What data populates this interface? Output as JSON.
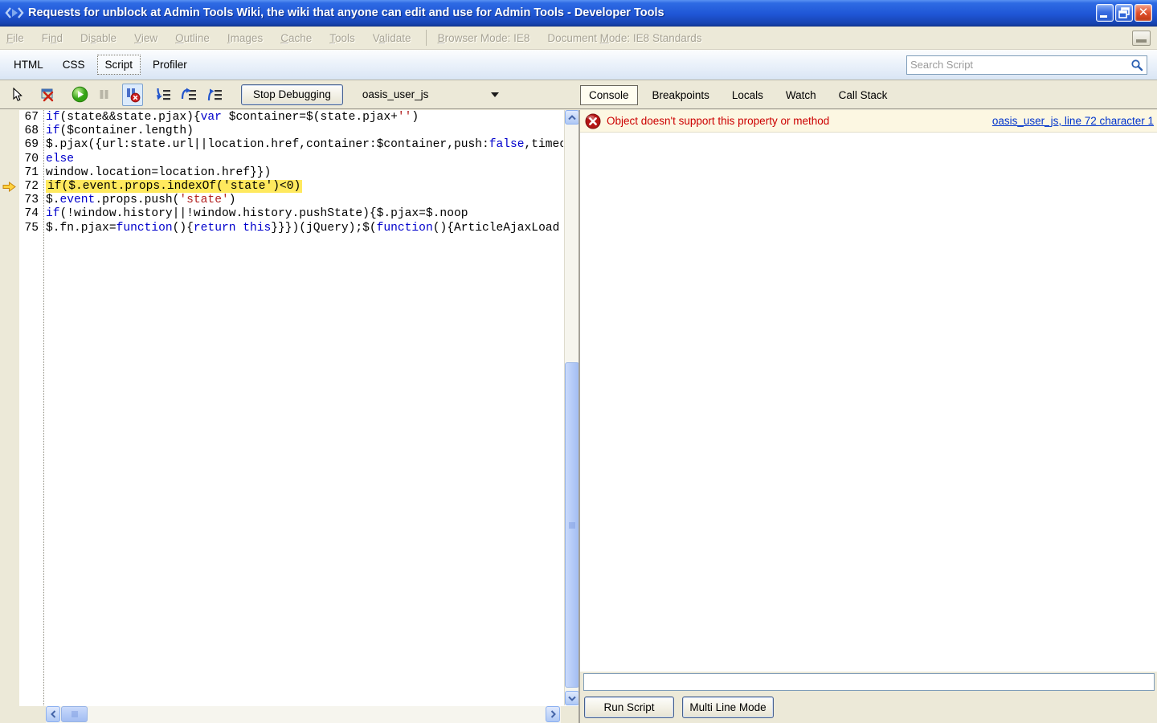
{
  "titlebar": {
    "title": "Requests for unblock at Admin Tools Wiki, the wiki that anyone can edit and use for Admin Tools - Developer Tools",
    "icon": "code-brackets-icon",
    "buttons": [
      "minimize-icon",
      "restore-icon",
      "close-icon"
    ]
  },
  "menubar": {
    "items": [
      {
        "label": "File",
        "u": 0
      },
      {
        "label": "Find",
        "u": 2
      },
      {
        "label": "Disable",
        "u": 2
      },
      {
        "label": "View",
        "u": 0
      },
      {
        "label": "Outline",
        "u": 0
      },
      {
        "label": "Images",
        "u": 0
      },
      {
        "label": "Cache",
        "u": 0
      },
      {
        "label": "Tools",
        "u": 0
      },
      {
        "label": "Validate",
        "u": 1
      }
    ],
    "modes": [
      {
        "label": "Browser Mode: IE8",
        "u": 0
      },
      {
        "label": "Document Mode: IE8 Standards",
        "u": 9
      }
    ],
    "pin_button": "minimize-pane-icon"
  },
  "dev_tabs": {
    "items": [
      {
        "label": "HTML",
        "selected": false
      },
      {
        "label": "CSS",
        "selected": false
      },
      {
        "label": "Script",
        "selected": true
      },
      {
        "label": "Profiler",
        "selected": false
      }
    ]
  },
  "search": {
    "placeholder": "Search Script",
    "icon": "search-icon"
  },
  "toolbar": {
    "icons": [
      "select-element-icon",
      "window-error-icon",
      "continue-icon",
      "break-all-icon",
      "break-on-error-icon",
      "step-into-icon",
      "step-over-icon",
      "step-out-icon"
    ],
    "stop_debugging_label": "Stop Debugging",
    "script_selector_value": "oasis_user_js",
    "script_selector_icon": "chevron-down-icon"
  },
  "console_tabs": {
    "items": [
      {
        "label": "Console",
        "selected": true
      },
      {
        "label": "Breakpoints",
        "selected": false
      },
      {
        "label": "Locals",
        "selected": false
      },
      {
        "label": "Watch",
        "selected": false
      },
      {
        "label": "Call Stack",
        "selected": false
      }
    ]
  },
  "console": {
    "error": {
      "icon": "error-icon",
      "message": "Object doesn't support this property or method",
      "location_link": "oasis_user_js, line 72 character 1"
    },
    "input_value": "",
    "run_button_label": "Run Script",
    "multiline_button_label": "Multi Line Mode"
  },
  "code": {
    "execution_line": 72,
    "lines": [
      {
        "num": 67,
        "tokens": [
          [
            "k",
            "if"
          ],
          [
            "p",
            "(state&&state.pjax){"
          ],
          [
            "k",
            "var"
          ],
          [
            "p",
            " $container=$(state.pjax+"
          ],
          [
            "s",
            "''"
          ],
          [
            "p",
            ")"
          ]
        ]
      },
      {
        "num": 68,
        "tokens": [
          [
            "k",
            "if"
          ],
          [
            "p",
            "($container.length)"
          ]
        ]
      },
      {
        "num": 69,
        "tokens": [
          [
            "p",
            "$.pjax({url:state.url||location.href,container:$container,push:"
          ],
          [
            "k",
            "false"
          ],
          [
            "p",
            ",timeout:"
          ]
        ]
      },
      {
        "num": 70,
        "tokens": [
          [
            "k",
            "else"
          ]
        ]
      },
      {
        "num": 71,
        "tokens": [
          [
            "p",
            "window.location=location.href}})"
          ]
        ]
      },
      {
        "num": 72,
        "highlight": true,
        "tokens": [
          [
            "p",
            "if($.event.props.indexOf('state')<0)"
          ]
        ]
      },
      {
        "num": 73,
        "tokens": [
          [
            "p",
            "$."
          ],
          [
            "k",
            "event"
          ],
          [
            "p",
            ".props.push("
          ],
          [
            "s",
            "'state'"
          ],
          [
            "p",
            ")"
          ]
        ]
      },
      {
        "num": 74,
        "tokens": [
          [
            "k",
            "if"
          ],
          [
            "p",
            "(!window.history||!window.history.pushState){$.pjax=$.noop"
          ]
        ]
      },
      {
        "num": 75,
        "tokens": [
          [
            "p",
            "$.fn.pjax="
          ],
          [
            "k",
            "function"
          ],
          [
            "p",
            "(){"
          ],
          [
            "k",
            "return"
          ],
          [
            "p",
            " "
          ],
          [
            "k",
            "this"
          ],
          [
            "p",
            "}}})(jQuery);$("
          ],
          [
            "k",
            "function"
          ],
          [
            "p",
            "(){ArticleAjaxLoad"
          ]
        ]
      }
    ]
  },
  "colors": {
    "titlebar_blue": "#1f56d6",
    "chrome_beige": "#ece9d8",
    "error_red": "#cc0000",
    "link_blue": "#0033cc",
    "highlight_yellow": "#ffe95e",
    "keyword_blue": "#0000cc",
    "string_red": "#b22222",
    "error_row_bg": "#fcf7e2"
  }
}
